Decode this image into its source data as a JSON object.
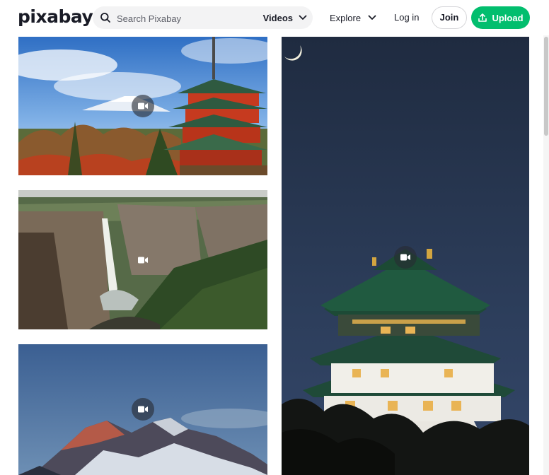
{
  "header": {
    "logo": "pixabay",
    "search": {
      "placeholder": "Search Pixabay",
      "media_type": "Videos"
    },
    "nav": {
      "explore": "Explore",
      "login": "Log in",
      "join": "Join",
      "upload": "Upload"
    }
  },
  "gallery": {
    "tiles": [
      {
        "subject": "pagoda-mount-fuji",
        "media": "video",
        "icon": "video-camera-icon"
      },
      {
        "subject": "waterfall-gorge",
        "media": "video",
        "icon": "video-camera-icon"
      },
      {
        "subject": "mountain-peak-dusk",
        "media": "video",
        "icon": "video-camera-icon"
      },
      {
        "subject": "osaka-castle-night",
        "media": "video",
        "icon": "video-camera-icon"
      }
    ]
  },
  "colors": {
    "brand_green": "#02be6e",
    "text_dark": "#191b26",
    "search_bg": "#f3f3f4"
  }
}
